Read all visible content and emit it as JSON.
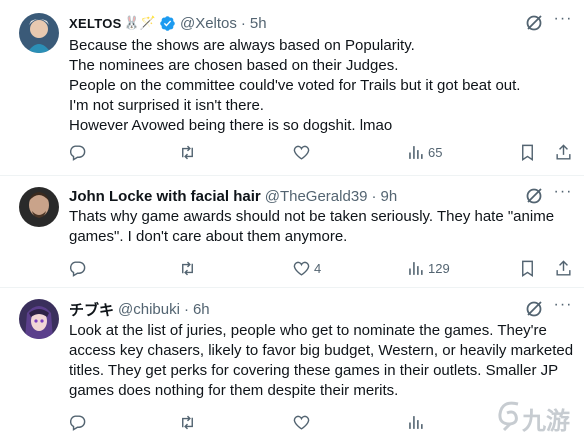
{
  "tweets": [
    {
      "name": "XELTOS",
      "emojis": "🐰🪄",
      "verified": true,
      "handle": "@Xeltos",
      "time": "5h",
      "lines": [
        "Because the shows are always based on Popularity.",
        "The nominees are chosen based on their Judges.",
        "People on the committee could've voted for Trails but it got beat out.",
        "I'm not surprised it isn't there.",
        "However Avowed being there is so dogshit. lmao"
      ],
      "likes": "",
      "views": "65"
    },
    {
      "name": "John Locke with facial hair",
      "emojis": "",
      "verified": false,
      "handle": "@TheGerald39",
      "time": "9h",
      "lines": [
        "Thats why game awards should not be taken seriously. They hate \"anime",
        "games\". I don't care about them anymore."
      ],
      "likes": "4",
      "views": "129"
    },
    {
      "name": "チブキ",
      "emojis": "",
      "verified": false,
      "handle": "@chibuki",
      "time": "6h",
      "lines": [
        "Look at the list of juries, people who get to nominate the games. They're",
        "access key chasers, likely to favor big budget, Western, or heavily marketed",
        "titles. They get perks for covering these games in their outlets. Smaller JP",
        "games does nothing for them despite their merits."
      ],
      "likes": "",
      "views": ""
    }
  ],
  "watermark": {
    "text": "九游"
  },
  "colors": {
    "text": "#0f1419",
    "secondary": "#536471",
    "verified": "#1d9bf0",
    "divider": "#eff3f4"
  }
}
